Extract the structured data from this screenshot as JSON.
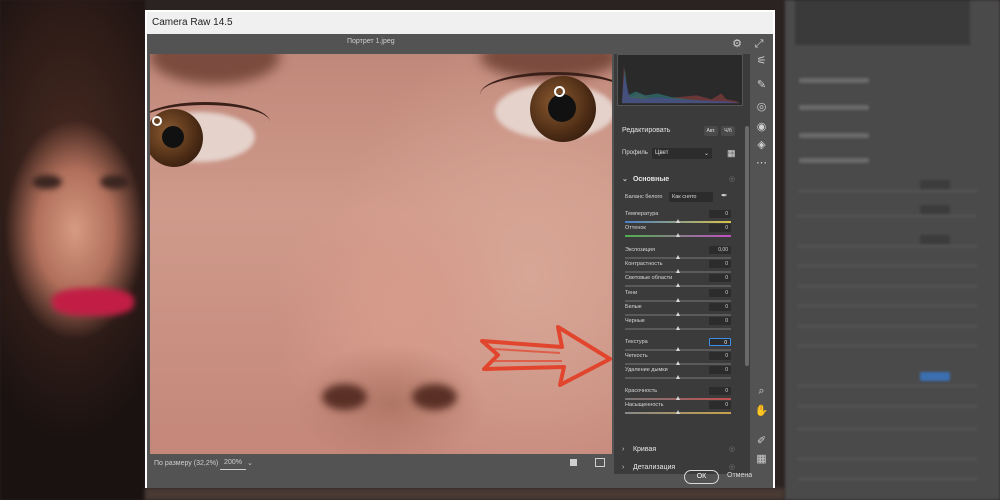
{
  "window": {
    "title": "Camera Raw 14.5",
    "filename": "Портрет 1.jpeg"
  },
  "status": {
    "fit_label": "По размеру (32,2%)",
    "zoom": "200%",
    "caret": "⌄"
  },
  "panel": {
    "edit_title": "Редактировать",
    "auto_label": "Авт.",
    "bw_label": "Ч/б",
    "profile_label": "Профиль",
    "profile_value": "Цвет",
    "basic_section": "Основные",
    "wb_label": "Баланс белого",
    "wb_value": "Как снято",
    "sliders": [
      {
        "label": "Температура",
        "value": "0",
        "position": 0.5,
        "track": "temp"
      },
      {
        "label": "Оттенок",
        "value": "0",
        "position": 0.5,
        "track": "tint"
      },
      {
        "label": "Экспозиция",
        "value": "0,00",
        "position": 0.5,
        "track": "gray"
      },
      {
        "label": "Контрастность",
        "value": "0",
        "position": 0.5,
        "track": "gray"
      },
      {
        "label": "Световые области",
        "value": "0",
        "position": 0.5,
        "track": "gray"
      },
      {
        "label": "Тени",
        "value": "0",
        "position": 0.5,
        "track": "gray"
      },
      {
        "label": "Белые",
        "value": "0",
        "position": 0.5,
        "track": "gray"
      },
      {
        "label": "Черные",
        "value": "0",
        "position": 0.5,
        "track": "gray"
      },
      {
        "label": "Текстура",
        "value": "0",
        "position": 0.5,
        "track": "gray",
        "active": true
      },
      {
        "label": "Четкость",
        "value": "0",
        "position": 0.5,
        "track": "gray"
      },
      {
        "label": "Удаление дымки",
        "value": "0",
        "position": 0.5,
        "track": "gray"
      },
      {
        "label": "Красочность",
        "value": "0",
        "position": 0.5,
        "track": "vib"
      },
      {
        "label": "Насыщенность",
        "value": "0",
        "position": 0.5,
        "track": "sat"
      }
    ],
    "curve_section": "Кривая",
    "detail_section": "Детализация"
  },
  "footer": {
    "ok": "ОК",
    "cancel": "Отмена"
  },
  "icons": {
    "gear": "⚙",
    "expand": "⤢",
    "edit": "⚟",
    "heal": "✎",
    "mask": "◎",
    "redeye": "◉",
    "presets": "◈",
    "more": "⋯",
    "zoom": "⌕",
    "hand": "✋",
    "sampler": "✐",
    "grid": "▦",
    "eye": "◎",
    "eyedropper": "✒",
    "chev_down": "⌄",
    "chev_right": "›"
  },
  "colors": {
    "accent": "#3b8eea",
    "annotation": "#e2452d",
    "panel_bg": "#3b3b3b",
    "window_bg": "#535353"
  }
}
